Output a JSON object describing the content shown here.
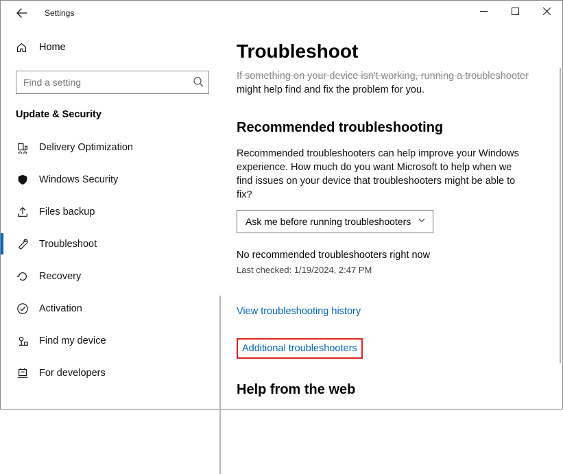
{
  "window": {
    "title": "Settings"
  },
  "sidebar": {
    "home_label": "Home",
    "search_placeholder": "Find a setting",
    "category": "Update & Security",
    "items": [
      {
        "label": "Delivery Optimization"
      },
      {
        "label": "Windows Security"
      },
      {
        "label": "Files backup"
      },
      {
        "label": "Troubleshoot"
      },
      {
        "label": "Recovery"
      },
      {
        "label": "Activation"
      },
      {
        "label": "Find my device"
      },
      {
        "label": "For developers"
      }
    ]
  },
  "main": {
    "title": "Troubleshoot",
    "intro_partial_top": "If something on your device isn't working, running a troubleshooter",
    "intro_partial_bottom": "might help find and fix the problem for you.",
    "rec_heading": "Recommended troubleshooting",
    "rec_body": "Recommended troubleshooters can help improve your Windows experience. How much do you want Microsoft to help when we find issues on your device that troubleshooters might be able to fix?",
    "dropdown_value": "Ask me before running troubleshooters",
    "status_none": "No recommended troubleshooters right now",
    "last_checked": "Last checked: 1/19/2024, 2:47 PM",
    "link_history": "View troubleshooting history",
    "link_additional": "Additional troubleshooters",
    "help_heading": "Help from the web"
  }
}
